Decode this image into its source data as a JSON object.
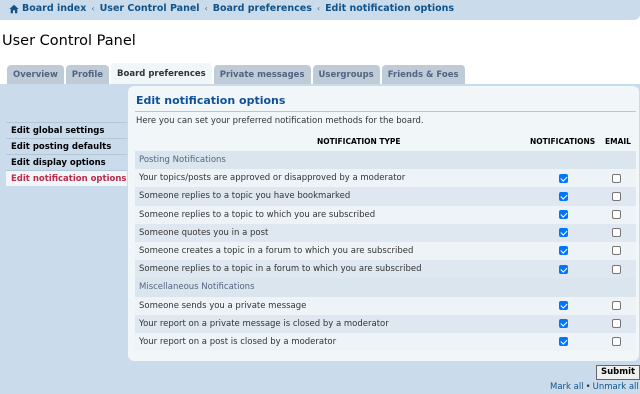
{
  "breadcrumb": {
    "items": [
      "Board index",
      "User Control Panel",
      "Board preferences",
      "Edit notification options"
    ],
    "separator": "‹"
  },
  "page_title": "User Control Panel",
  "tabs": [
    {
      "label": "Overview",
      "active": false
    },
    {
      "label": "Profile",
      "active": false
    },
    {
      "label": "Board preferences",
      "active": true
    },
    {
      "label": "Private messages",
      "active": false
    },
    {
      "label": "Usergroups",
      "active": false
    },
    {
      "label": "Friends & Foes",
      "active": false
    }
  ],
  "sidebar": {
    "items": [
      {
        "label": "Edit global settings",
        "active": false
      },
      {
        "label": "Edit posting defaults",
        "active": false
      },
      {
        "label": "Edit display options",
        "active": false
      },
      {
        "label": "Edit notification options",
        "active": true
      }
    ]
  },
  "main": {
    "title": "Edit notification options",
    "intro": "Here you can set your preferred notification methods for the board.",
    "columns": {
      "type": "NOTIFICATION TYPE",
      "notifications": "NOTIFICATIONS",
      "email": "EMAIL"
    },
    "rows": [
      {
        "kind": "section",
        "label": "Posting Notifications"
      },
      {
        "kind": "option",
        "label": "Your topics/posts are approved or disapproved by a moderator",
        "notification": true,
        "email": false
      },
      {
        "kind": "option",
        "label": "Someone replies to a topic you have bookmarked",
        "notification": true,
        "email": false
      },
      {
        "kind": "option",
        "label": "Someone replies to a topic to which you are subscribed",
        "notification": true,
        "email": false
      },
      {
        "kind": "option",
        "label": "Someone quotes you in a post",
        "notification": true,
        "email": false
      },
      {
        "kind": "option",
        "label": "Someone creates a topic in a forum to which you are subscribed",
        "notification": true,
        "email": false
      },
      {
        "kind": "option",
        "label": "Someone replies to a topic in a forum to which you are subscribed",
        "notification": true,
        "email": false
      },
      {
        "kind": "section",
        "label": "Miscellaneous Notifications"
      },
      {
        "kind": "option",
        "label": "Someone sends you a private message",
        "notification": true,
        "email": false
      },
      {
        "kind": "option",
        "label": "Your report on a private message is closed by a moderator",
        "notification": true,
        "email": false
      },
      {
        "kind": "option",
        "label": "Your report on a post is closed by a moderator",
        "notification": true,
        "email": false
      }
    ]
  },
  "footer": {
    "submit_label": "Submit",
    "mark_all": "Mark all",
    "unmark_all": "Unmark all",
    "link_separator": "•"
  },
  "colors": {
    "accent": "#105289",
    "active_side_item": "#bc2a4d",
    "panel_bg": "#cadceb",
    "content_bg": "#f1f6f9",
    "checkbox_checked": "#0075ff"
  }
}
